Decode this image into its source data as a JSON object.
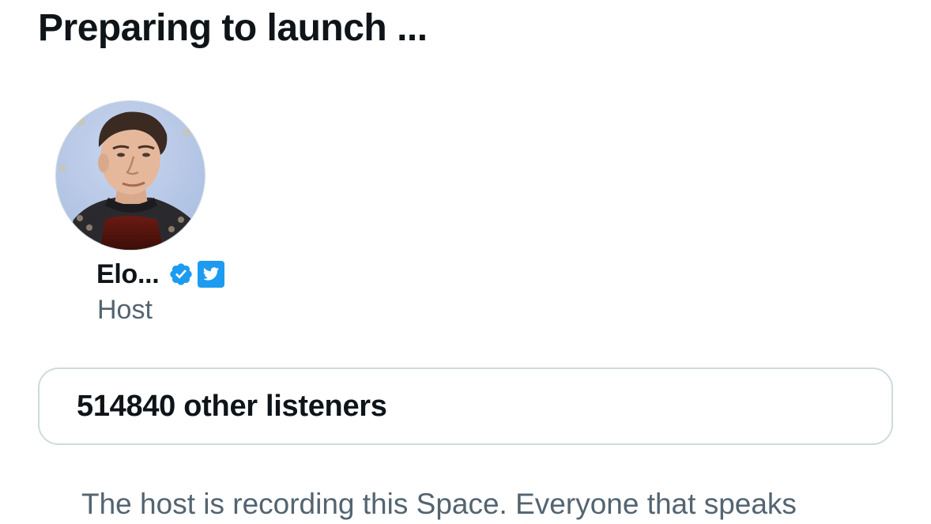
{
  "header": {
    "title": "Preparing to launch ..."
  },
  "host": {
    "name": "Elo...",
    "role": "Host",
    "avatar_icon": "profile-photo",
    "badges": [
      "verified-icon",
      "twitter-affiliate-icon"
    ]
  },
  "listeners": {
    "label": "514840 other listeners"
  },
  "notice": {
    "text": "The host is recording this Space. Everyone that speaks"
  },
  "colors": {
    "text_primary": "#0f1419",
    "text_secondary": "#536471",
    "border": "#cfd9de",
    "verified_blue": "#1d9bf0",
    "avatar_bg": "#b7c9e6"
  }
}
